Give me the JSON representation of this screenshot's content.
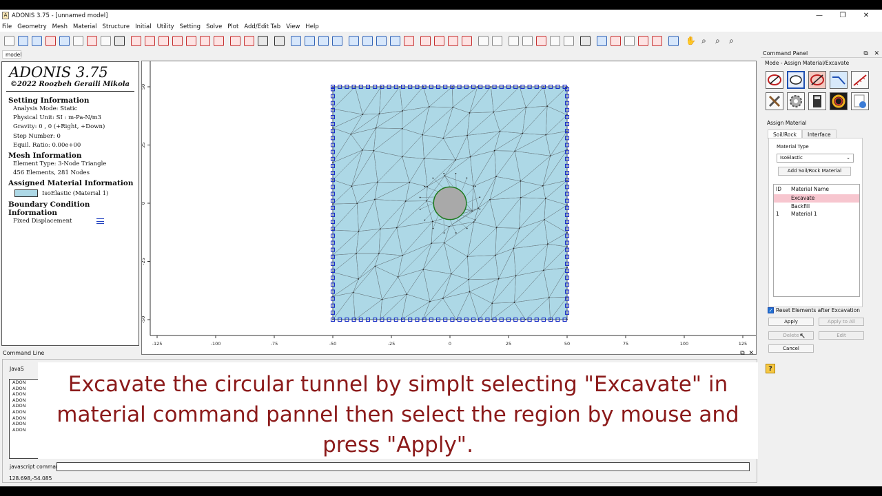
{
  "window": {
    "title": "ADONIS 3.75 - [unnamed model]",
    "app_icon": "A",
    "controls": [
      "—",
      "❐",
      "✕"
    ]
  },
  "menu": [
    "File",
    "Geometry",
    "Mesh",
    "Material",
    "Structure",
    "Initial",
    "Utility",
    "Setting",
    "Solve",
    "Plot",
    "Add/Edit Tab",
    "View",
    "Help"
  ],
  "model_tab": "model",
  "info": {
    "app_name": "ADONIS 3.75",
    "copyright": "©2022 Roozbeh Geraili Mikola",
    "setting_title": "Setting Information",
    "setting_rows": [
      "Analysis Mode: Static",
      "Physical Unit: SI : m-Pa-N/m3",
      "Gravity: 0 , 0 (+Right, +Down)",
      "Step Number: 0",
      "Equil. Ratio: 0.00e+00"
    ],
    "mesh_title": "Mesh Information",
    "mesh_rows": [
      "Element Type: 3-Node Triangle",
      "456 Elements, 281 Nodes"
    ],
    "material_title": "Assigned Material Information",
    "material_legend": "IsoElastic (Material 1)",
    "material_color": "#add8e6",
    "bc_title": "Boundary Condition Information",
    "bc_legend": "Fixed Displacement"
  },
  "plot": {
    "x_ticks": [
      "-125",
      "-100",
      "-75",
      "-50",
      "-25",
      "0",
      "25",
      "50",
      "75",
      "100",
      "125"
    ],
    "y_ticks": [
      "50",
      "25",
      "0",
      "-25",
      "-50"
    ],
    "domain_color": "#add8e6",
    "tunnel_color": "#a9a9a9",
    "tunnel_outline_color": "#1e7a1e",
    "bc_color": "#1a2fc8",
    "domain": {
      "xmin": -50,
      "xmax": 50,
      "ymin": -50,
      "ymax": 50
    },
    "tunnel": {
      "cx": 0,
      "cy": 0,
      "r": 7
    }
  },
  "command_line": {
    "header": "Command Line",
    "js_label": "JavaS",
    "log_lines": [
      "ADON",
      "ADON",
      "ADON",
      "ADON",
      "ADON",
      "ADON",
      "ADON",
      "ADON",
      "ADON"
    ],
    "input_label": "javascript command",
    "controls": [
      "⧉",
      "✕"
    ]
  },
  "caption": {
    "line1": "Excavate the circular tunnel by simplt selecting \"Excavate\" in",
    "line2": "material command pannel then select the region by mouse and",
    "line3": "press \"Apply\"."
  },
  "status": {
    "coords": "128.698,-54.085"
  },
  "command_panel": {
    "header": "Command Panel",
    "controls": [
      "⧉",
      "✕"
    ],
    "mode": "Mode - Assign Material/Excavate",
    "section": "Assign Material",
    "tabs": [
      "Soil/Rock",
      "Interface"
    ],
    "material_type_label": "Material Type",
    "material_type_value": "IsoElastic",
    "add_button": "Add Soil/Rock Material",
    "list_headers": [
      "ID",
      "Material Name"
    ],
    "list_rows": [
      {
        "id": "",
        "name": "Excavate"
      },
      {
        "id": "",
        "name": "Backfill"
      },
      {
        "id": "1",
        "name": "Material 1"
      }
    ],
    "selected_color": "#f7c6cf",
    "reset_label": "Reset Elements after Excavation",
    "buttons": {
      "apply": "Apply",
      "apply_all": "Apply to All",
      "delete": "Delete",
      "edit": "Edit",
      "cancel": "Cancel"
    },
    "help": "?"
  }
}
